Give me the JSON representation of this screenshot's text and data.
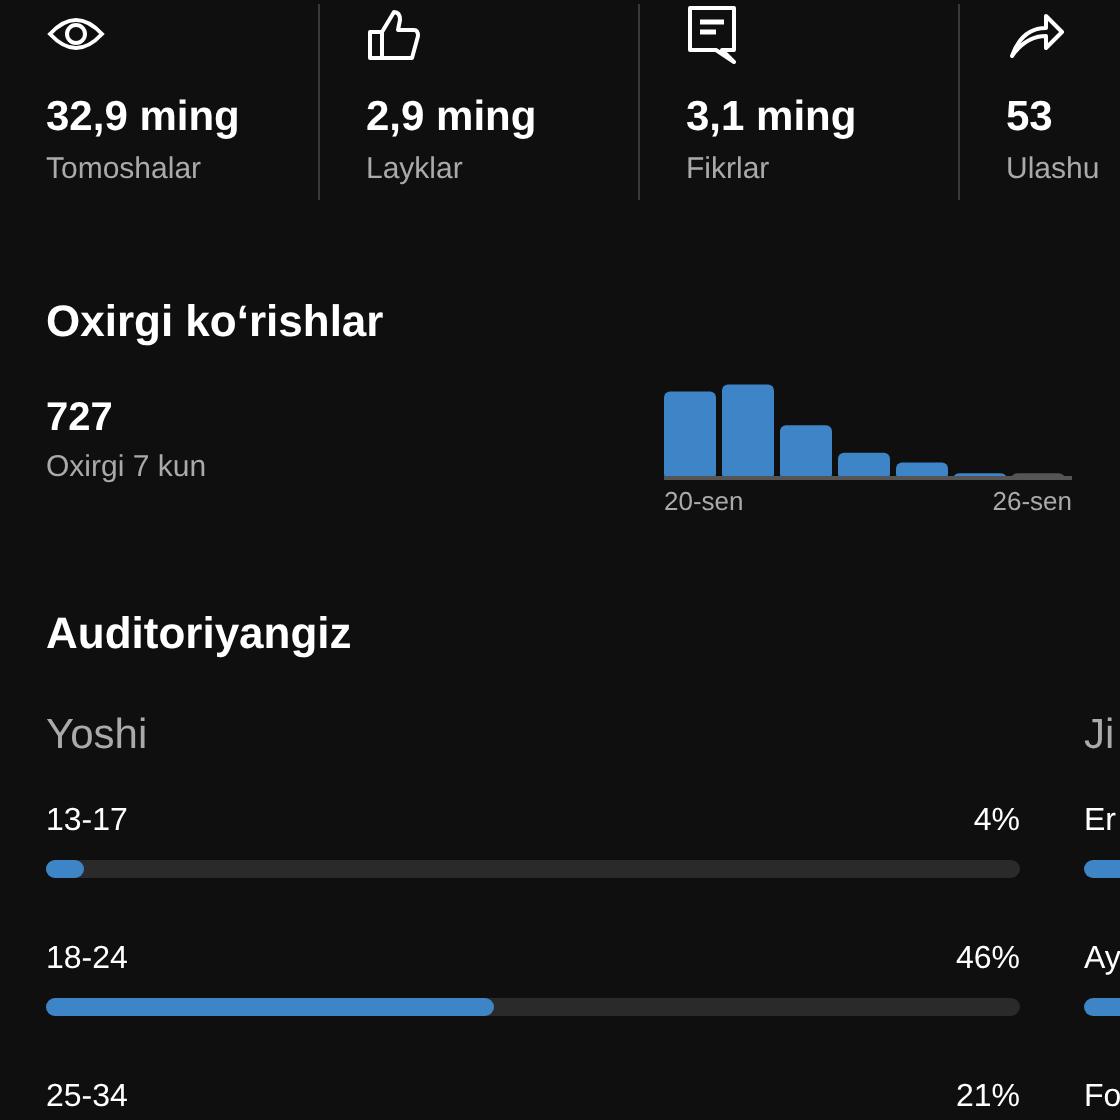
{
  "stats": [
    {
      "value": "32,9 ming",
      "label": "Tomoshalar"
    },
    {
      "value": "2,9 ming",
      "label": "Layklar"
    },
    {
      "value": "3,1 ming",
      "label": "Fikrlar"
    },
    {
      "value": "53",
      "label": "Ulashu"
    }
  ],
  "recent": {
    "title": "Oxirgi ko‘rishlar",
    "count": "727",
    "period": "Oxirgi 7 kun",
    "axis_start": "20-sen",
    "axis_end": "26-sen"
  },
  "audience": {
    "title": "Auditoriyangiz",
    "age": {
      "title": "Yoshi",
      "groups": [
        {
          "label": "13-17",
          "percent": "4%",
          "level": 0.04
        },
        {
          "label": "18-24",
          "percent": "46%",
          "level": 0.46
        },
        {
          "label": "25-34",
          "percent": "21%"
        }
      ]
    },
    "gender": {
      "title": "Ji",
      "groups": [
        {
          "label": "Er"
        },
        {
          "label": "Ay"
        },
        {
          "label": "Fo"
        }
      ]
    }
  }
}
